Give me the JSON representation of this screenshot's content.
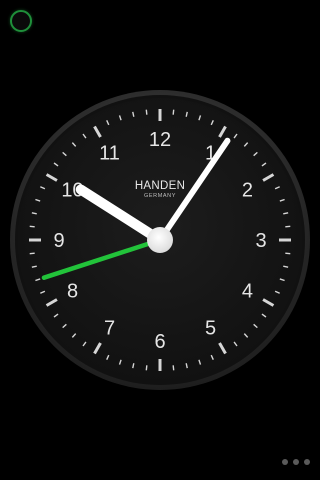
{
  "clock": {
    "brand": "HANDEN",
    "origin": "GERMANY",
    "numerals": [
      "12",
      "1",
      "2",
      "3",
      "4",
      "5",
      "6",
      "7",
      "8",
      "9",
      "10",
      "11"
    ],
    "time": {
      "hours": 10,
      "minutes": 5,
      "seconds": 42
    },
    "colors": {
      "face": "#161616",
      "bezel": "#3a3a3a",
      "hands": "#ffffff",
      "second_hand": "#22c33a",
      "ticks": "#d6d6d6"
    }
  },
  "controls": {
    "top_toggle_icon": "circle-outline-icon",
    "page_dots_icon": "page-dots-icon",
    "page_count": 3
  }
}
